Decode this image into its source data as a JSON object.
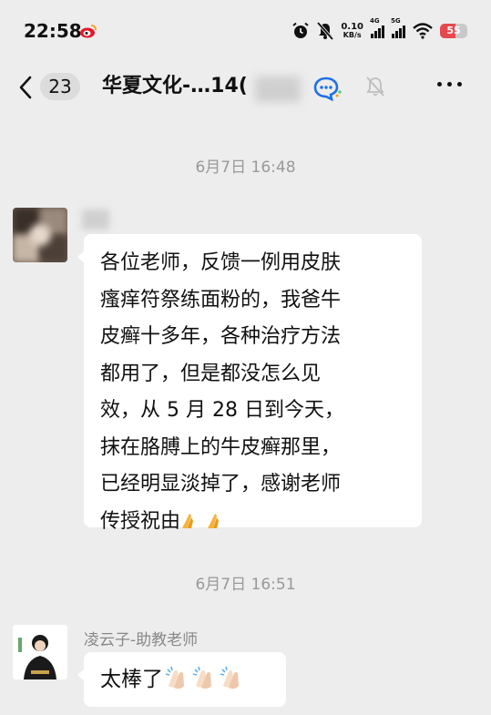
{
  "status_bar": {
    "time": "22:58",
    "net_speed_value": "0.10",
    "net_speed_unit": "KB/s",
    "signal1_type": "4G",
    "signal2_type": "5G",
    "battery_level": "55",
    "icons": [
      "weibo-icon",
      "alarm-icon",
      "mute-icon",
      "wifi-icon",
      "battery-icon"
    ]
  },
  "nav": {
    "unread_count": "23",
    "title": "华夏文化-…14(",
    "icons": [
      "back-arrow-icon",
      "chat-bubble-icon",
      "bell-mute-icon",
      "more-icon"
    ]
  },
  "messages": [
    {
      "timestamp": "6月7日 16:48",
      "lines": [
        "各位老师，反馈一例用皮肤",
        "瘙痒符祭练面粉的，我爸牛",
        "皮癣十多年，各种治疗方法",
        "都用了，但是都没怎么见",
        "效，从 5 月 28 日到今天，",
        "抹在胳膊上的牛皮癣那里，",
        "已经明显淡掉了，感谢老师",
        "传授祝由"
      ],
      "emoji": "folded-hands-emoji"
    },
    {
      "timestamp": "6月7日 16:51",
      "sender": "凌云子-助教老师",
      "text": "太棒了",
      "emoji": "clapping-hands-emoji"
    }
  ],
  "colors": {
    "background": "#ededed",
    "bubble": "#ffffff",
    "timestamp": "#999999",
    "battery_low": "#e5484d"
  }
}
